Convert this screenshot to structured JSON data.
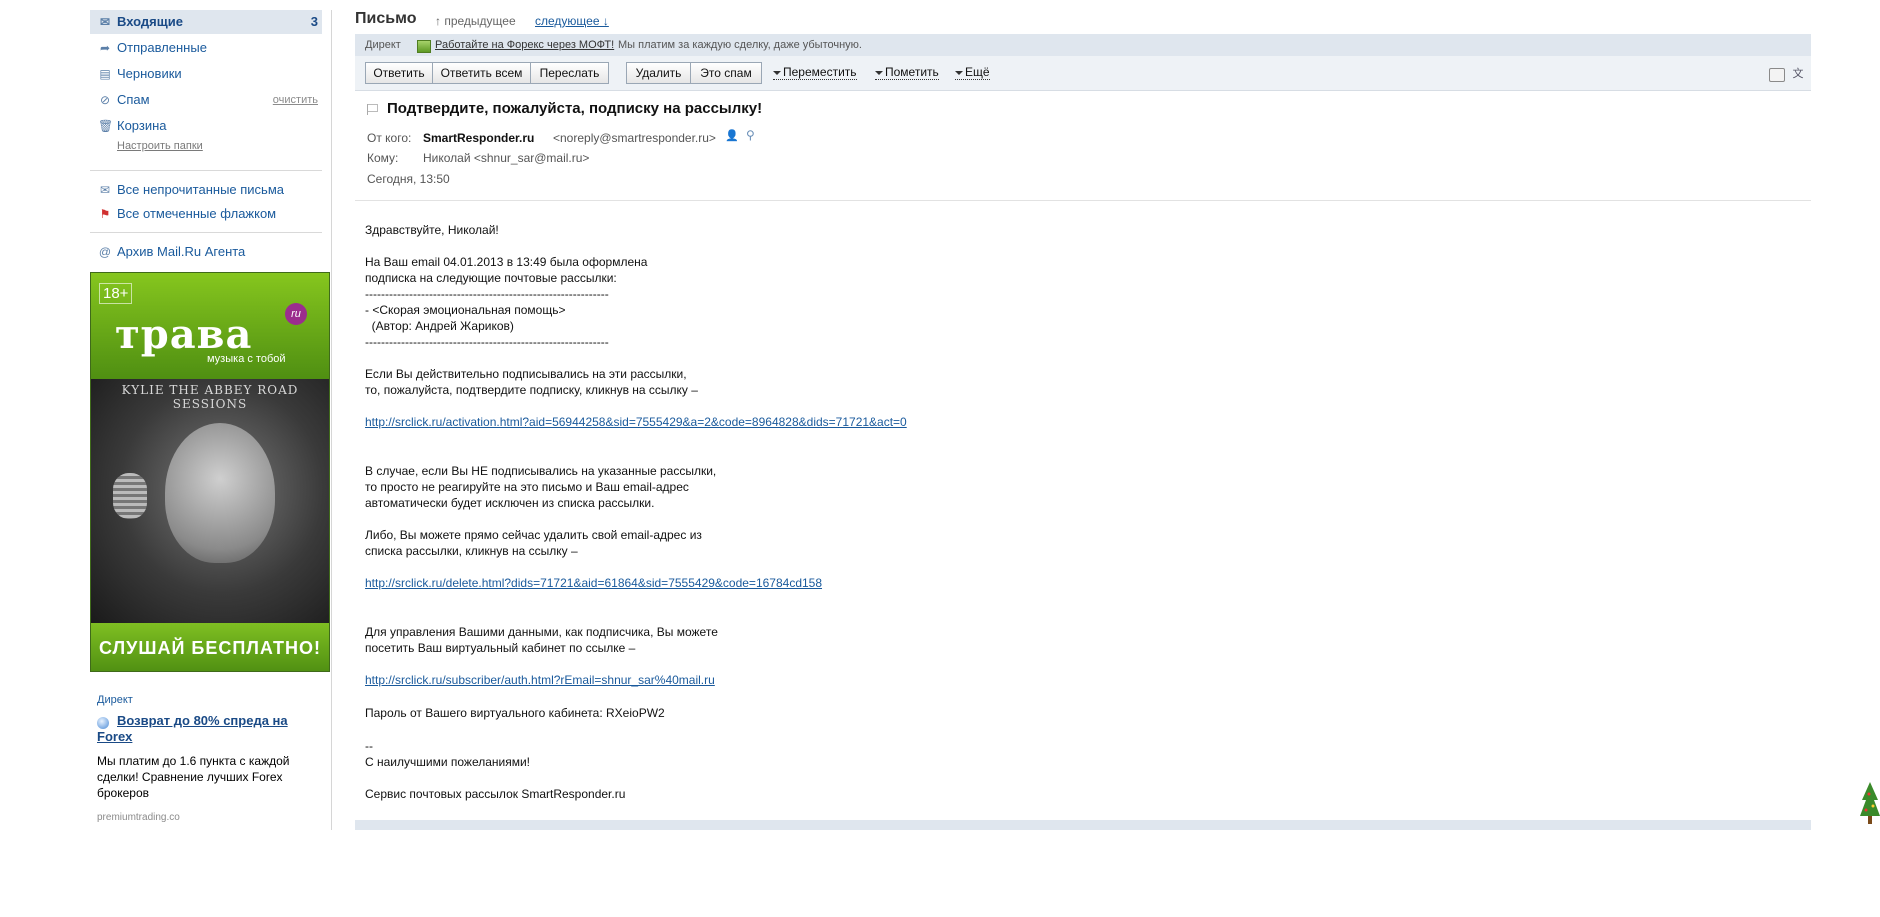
{
  "sidebar": {
    "folders": [
      {
        "label": "Входящие",
        "count": "3"
      },
      {
        "label": "Отправленные"
      },
      {
        "label": "Черновики"
      },
      {
        "label": "Спам",
        "action": "очистить"
      },
      {
        "label": "Корзина"
      }
    ],
    "setup_link": "Настроить папки",
    "filters": [
      {
        "label": "Все непрочитанные письма"
      },
      {
        "label": "Все отмеченные флажком"
      }
    ],
    "agent_archive": "Архив Mail.Ru Агента",
    "banner": {
      "age": "18+",
      "logo": "трава",
      "logo_badge": "ru",
      "tagline": "музыка с тобой",
      "artist": "KYLIE THE ABBEY ROAD SESSIONS",
      "cta": "СЛУШАЙ БЕСПЛАТНО!"
    },
    "direct_ad": {
      "label": "Директ",
      "title": "Возврат до 80% спреда на Forex",
      "text": "Мы платим до 1.6 пункта с каждой сделки! Сравнение лучших Forex брокеров",
      "domain": "premiumtrading.co"
    }
  },
  "main": {
    "title": "Письмо",
    "prev": "↑ предыдущее",
    "next": "следующее ↓",
    "direct_bar": {
      "label": "Директ",
      "link": "Работайте на Форекс через МОФТ!",
      "text": "Мы платим за каждую сделку, даже убыточную."
    },
    "toolbar": {
      "reply": "Ответить",
      "reply_all": "Ответить всем",
      "forward": "Переслать",
      "delete": "Удалить",
      "spam": "Это спам",
      "move": "Переместить",
      "mark": "Пометить",
      "more": "Ещё"
    },
    "message": {
      "subject": "Подтвердите, пожалуйста, подписку на рассылку!",
      "from_label": "От кого:",
      "from_name": "SmartResponder.ru",
      "from_addr": "<noreply@smartresponder.ru>",
      "to_label": "Кому:",
      "to_value": "Николай <shnur_sar@mail.ru>",
      "date": "Сегодня, 13:50",
      "body": {
        "greeting": "Здравствуйте, Николай!",
        "p1": "На Ваш email 04.01.2013 в 13:49 была оформлена\nподписка на следующие почтовые рассылки:\n-------------------------------------------------------------\n- <Скорая эмоциональная помощь>\n  (Автор: Андрей Жариков)\n-------------------------------------------------------------",
        "p2": "Если Вы действительно подписывались на эти рассылки,\nто, пожалуйста, подтвердите подписку, кликнув на ссылку –",
        "link1": "http://srclick.ru/activation.html?aid=56944258&sid=7555429&a=2&code=8964828&dids=71721&act=0",
        "p3": "В случае, если Вы НЕ подписывались на указанные рассылки,\nто просто не реагируйте на это письмо и Ваш email-адрес\nавтоматически будет исключен из списка рассылки.",
        "p4": "Либо, Вы можете прямо сейчас удалить свой email-адрес из\nсписка рассылки, кликнув на ссылку –",
        "link2": "http://srclick.ru/delete.html?dids=71721&aid=61864&sid=7555429&code=16784cd158",
        "p5": "Для управления Вашими данными, как подписчика, Вы можете\nпосетить Ваш виртуальный кабинет по ссылке –",
        "link3": "http://srclick.ru/subscriber/auth.html?rEmail=shnur_sar%40mail.ru",
        "p6": "Пароль от Вашего виртуального кабинета: RXeioPW2",
        "p7": "--\nС наилучшими пожеланиями!",
        "p8": "Сервис почтовых рассылок SmartResponder.ru"
      }
    }
  },
  "colors": {
    "link": "#1a5a9c",
    "toolbar_bg": "#eef2f6",
    "direct_bg": "#dfe6ee",
    "banner_green": "#6aaf1a"
  }
}
